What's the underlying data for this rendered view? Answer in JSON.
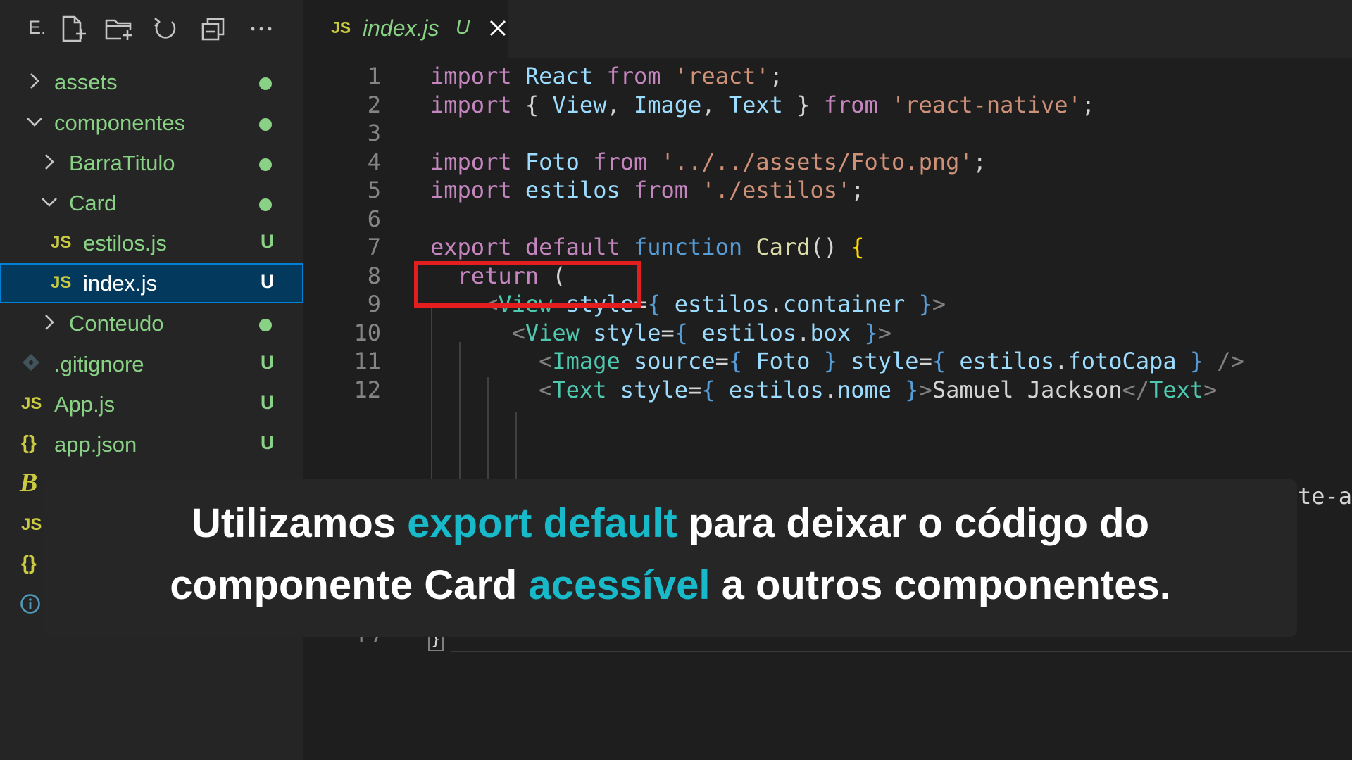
{
  "toolbar": {
    "label": "E.",
    "icons": [
      "new-file-icon",
      "new-folder-icon",
      "refresh-icon",
      "collapse-all-icon",
      "more-icon"
    ]
  },
  "tree": [
    {
      "name": "assets",
      "type": "folder",
      "expanded": false,
      "status": "dot"
    },
    {
      "name": "componentes",
      "type": "folder",
      "expanded": true,
      "status": "dot"
    },
    {
      "name": "BarraTitulo",
      "type": "folder",
      "expanded": false,
      "status": "dot"
    },
    {
      "name": "Card",
      "type": "folder",
      "expanded": true,
      "status": "dot"
    },
    {
      "name": "estilos.js",
      "type": "js",
      "icon_text": "JS",
      "status": "U"
    },
    {
      "name": "index.js",
      "type": "js",
      "icon_text": "JS",
      "status": "U",
      "selected": true
    },
    {
      "name": "Conteudo",
      "type": "folder",
      "expanded": false,
      "status": "dot"
    },
    {
      "name": ".gitignore",
      "type": "git",
      "status": "U"
    },
    {
      "name": "App.js",
      "type": "js",
      "icon_text": "JS",
      "status": "U"
    },
    {
      "name": "app.json",
      "type": "json",
      "icon_text": "{}",
      "status": "U"
    }
  ],
  "tree_partial": {
    "babel_icon_text": "B",
    "js_icon_text": "JS",
    "json_icon_text": "{}"
  },
  "tab": {
    "icon_text": "JS",
    "filename": "index.js",
    "status": "U"
  },
  "code_lines": [
    {
      "n": "1",
      "tokens": [
        [
          "kw",
          "import"
        ],
        [
          "punc",
          " "
        ],
        [
          "var",
          "React"
        ],
        [
          "punc",
          " "
        ],
        [
          "kw",
          "from"
        ],
        [
          "punc",
          " "
        ],
        [
          "str",
          "'react'"
        ],
        [
          "punc",
          ";"
        ]
      ]
    },
    {
      "n": "2",
      "tokens": [
        [
          "kw",
          "import"
        ],
        [
          "punc",
          " { "
        ],
        [
          "var",
          "View"
        ],
        [
          "punc",
          ", "
        ],
        [
          "var",
          "Image"
        ],
        [
          "punc",
          ", "
        ],
        [
          "var",
          "Text"
        ],
        [
          "punc",
          " } "
        ],
        [
          "kw",
          "from"
        ],
        [
          "punc",
          " "
        ],
        [
          "str",
          "'react-native'"
        ],
        [
          "punc",
          ";"
        ]
      ]
    },
    {
      "n": "3",
      "tokens": []
    },
    {
      "n": "4",
      "tokens": [
        [
          "kw",
          "import"
        ],
        [
          "punc",
          " "
        ],
        [
          "var",
          "Foto"
        ],
        [
          "punc",
          " "
        ],
        [
          "kw",
          "from"
        ],
        [
          "punc",
          " "
        ],
        [
          "str",
          "'../../assets/Foto.png'"
        ],
        [
          "punc",
          ";"
        ]
      ]
    },
    {
      "n": "5",
      "tokens": [
        [
          "kw",
          "import"
        ],
        [
          "punc",
          " "
        ],
        [
          "var",
          "estilos"
        ],
        [
          "punc",
          " "
        ],
        [
          "kw",
          "from"
        ],
        [
          "punc",
          " "
        ],
        [
          "str",
          "'./estilos'"
        ],
        [
          "punc",
          ";"
        ]
      ]
    },
    {
      "n": "6",
      "tokens": []
    },
    {
      "n": "7",
      "tokens": [
        [
          "kw",
          "export"
        ],
        [
          "punc",
          " "
        ],
        [
          "kw",
          "default"
        ],
        [
          "punc",
          " "
        ],
        [
          "sfn",
          "function"
        ],
        [
          "punc",
          " "
        ],
        [
          "fn",
          "Card"
        ],
        [
          "punc",
          "() "
        ],
        [
          "fnbrace",
          "{"
        ]
      ]
    },
    {
      "n": "8",
      "tokens": [
        [
          "punc",
          "  "
        ],
        [
          "kw",
          "return"
        ],
        [
          "punc",
          " ("
        ]
      ]
    },
    {
      "n": "9",
      "tokens": [
        [
          "punc",
          "    "
        ],
        [
          "jsxbr",
          "<"
        ],
        [
          "tag",
          "View"
        ],
        [
          "punc",
          " "
        ],
        [
          "var",
          "style"
        ],
        [
          "punc",
          "="
        ],
        [
          "sfn",
          "{"
        ],
        [
          "punc",
          " "
        ],
        [
          "var",
          "estilos"
        ],
        [
          "punc",
          "."
        ],
        [
          "var",
          "container"
        ],
        [
          "punc",
          " "
        ],
        [
          "sfn",
          "}"
        ],
        [
          "jsxbr",
          ">"
        ]
      ]
    },
    {
      "n": "10",
      "tokens": [
        [
          "punc",
          "      "
        ],
        [
          "jsxbr",
          "<"
        ],
        [
          "tag",
          "View"
        ],
        [
          "punc",
          " "
        ],
        [
          "var",
          "style"
        ],
        [
          "punc",
          "="
        ],
        [
          "sfn",
          "{"
        ],
        [
          "punc",
          " "
        ],
        [
          "var",
          "estilos"
        ],
        [
          "punc",
          "."
        ],
        [
          "var",
          "box"
        ],
        [
          "punc",
          " "
        ],
        [
          "sfn",
          "}"
        ],
        [
          "jsxbr",
          ">"
        ]
      ]
    },
    {
      "n": "11",
      "tokens": [
        [
          "punc",
          "        "
        ],
        [
          "jsxbr",
          "<"
        ],
        [
          "tag",
          "Image"
        ],
        [
          "punc",
          " "
        ],
        [
          "var",
          "source"
        ],
        [
          "punc",
          "="
        ],
        [
          "sfn",
          "{"
        ],
        [
          "punc",
          " "
        ],
        [
          "var",
          "Foto"
        ],
        [
          "punc",
          " "
        ],
        [
          "sfn",
          "}"
        ],
        [
          "punc",
          " "
        ],
        [
          "var",
          "style"
        ],
        [
          "punc",
          "="
        ],
        [
          "sfn",
          "{"
        ],
        [
          "punc",
          " "
        ],
        [
          "var",
          "estilos"
        ],
        [
          "punc",
          "."
        ],
        [
          "var",
          "fotoCapa"
        ],
        [
          "punc",
          " "
        ],
        [
          "sfn",
          "}"
        ],
        [
          "punc",
          " "
        ],
        [
          "jsxbr",
          "/>"
        ]
      ]
    },
    {
      "n": "12",
      "tokens": [
        [
          "punc",
          "        "
        ],
        [
          "jsxbr",
          "<"
        ],
        [
          "tag",
          "Text"
        ],
        [
          "punc",
          " "
        ],
        [
          "var",
          "style"
        ],
        [
          "punc",
          "="
        ],
        [
          "sfn",
          "{"
        ],
        [
          "punc",
          " "
        ],
        [
          "var",
          "estilos"
        ],
        [
          "punc",
          "."
        ],
        [
          "var",
          "nome"
        ],
        [
          "punc",
          " "
        ],
        [
          "sfn",
          "}"
        ],
        [
          "jsxbr",
          ">"
        ],
        [
          "punc",
          "Samuel Jackson"
        ],
        [
          "jsxbr",
          "</"
        ],
        [
          "tag",
          "Text"
        ],
        [
          "jsxbr",
          ">"
        ]
      ]
    }
  ],
  "partial_line_number": "17",
  "edge_text": "te-ar",
  "bottom_bracket": "}",
  "caption": {
    "line1_a": "Utilizamos ",
    "line1_accent": "export default",
    "line1_b": " para deixar o código do",
    "line2_a": "componente Card ",
    "line2_accent": "acessível",
    "line2_b": " a outros componentes."
  },
  "colors": {
    "accent": "#18b9c9",
    "highlight_box": "#e41e1e",
    "git_untracked": "#89d185",
    "selection": "#04395e"
  }
}
